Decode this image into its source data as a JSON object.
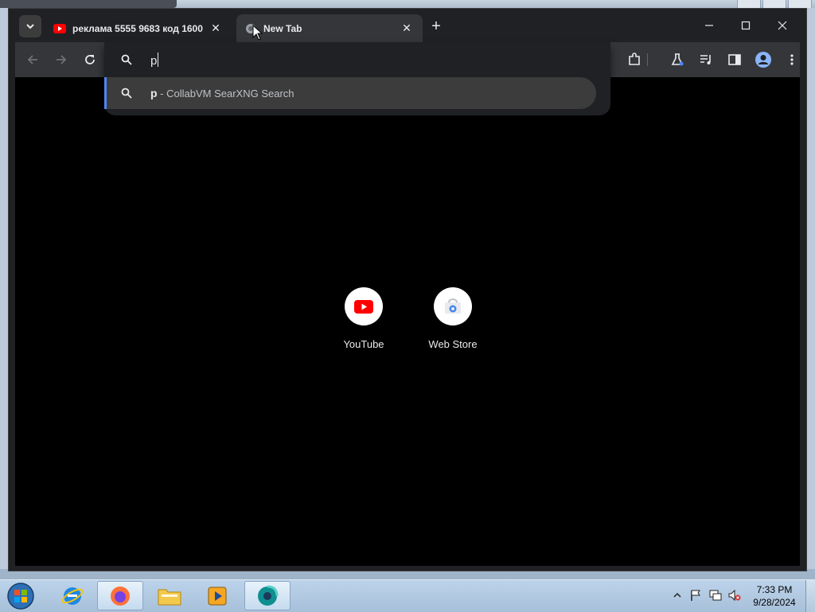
{
  "browser": {
    "tabs": [
      {
        "title": "реклама 5555 9683 код 1600",
        "favicon": "youtube-icon",
        "active": false
      },
      {
        "title": "New Tab",
        "favicon": "globe-icon",
        "active": true
      }
    ],
    "window_controls": [
      "minimize-icon",
      "maximize-icon",
      "close-icon"
    ]
  },
  "omnibox": {
    "input_value": "p",
    "suggestion": {
      "query": "p",
      "engine_text": " - CollabVM SearXNG Search"
    }
  },
  "shortcuts": [
    {
      "label": "YouTube",
      "icon": "youtube-icon"
    },
    {
      "label": "Web Store",
      "icon": "webstore-icon"
    }
  ],
  "taskbar": {
    "items": [
      "start-orb",
      "internet-explorer-icon",
      "firefox-icon",
      "file-explorer-icon",
      "media-player-icon",
      "chrome-browser-icon"
    ],
    "clock": {
      "time": "7:33 PM",
      "date": "9/28/2024"
    }
  },
  "colors": {
    "accent": "#4f86f7",
    "youtube_red": "#ff0000",
    "chrome_dark": "#202124"
  }
}
